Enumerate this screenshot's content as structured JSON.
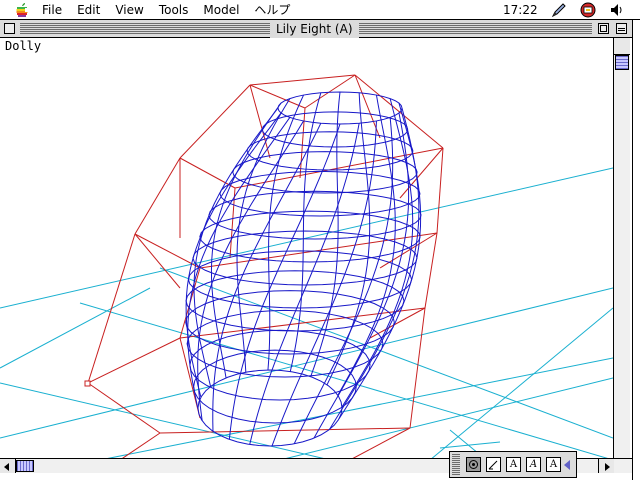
{
  "menubar": {
    "items": [
      "File",
      "Edit",
      "View",
      "Tools",
      "Model",
      "ヘルプ"
    ],
    "clock": "17:22",
    "icons": [
      "apple-icon",
      "pencil-icon",
      "app-menu-icon",
      "speaker-icon"
    ]
  },
  "window": {
    "title": "Lily Eight (A)",
    "view_label": "Dolly"
  },
  "palette": {
    "tools": [
      "dolly-tool-icon",
      "edit-tool-icon",
      "text-tool-icon",
      "italic-text-tool-icon",
      "label-tool-icon"
    ],
    "tool_glyphs": [
      "",
      "",
      "A",
      "A",
      "A"
    ]
  },
  "colors": {
    "wire_blue": "#1818c8",
    "cage_red": "#c82020",
    "grid_cyan": "#1ab0d0",
    "scroll_thumb": "#c8c8ff"
  }
}
